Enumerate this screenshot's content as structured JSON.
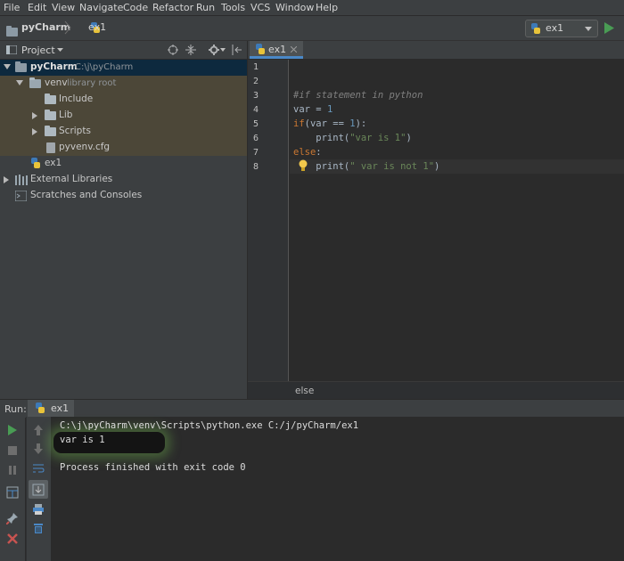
{
  "menu": [
    "File",
    "Edit",
    "View",
    "Navigate",
    "Code",
    "Refactor",
    "Run",
    "Tools",
    "VCS",
    "Window",
    "Help"
  ],
  "navbar": {
    "project": "pyCharm",
    "file": "ex1",
    "run_config": "ex1"
  },
  "project_panel": {
    "title": "Project",
    "tree": [
      {
        "label": "pyCharm",
        "hint": "C:\\j\\pyCharm"
      },
      {
        "label": "venv",
        "hint": "library root"
      },
      {
        "label": "Include"
      },
      {
        "label": "Lib"
      },
      {
        "label": "Scripts"
      },
      {
        "label": "pyvenv.cfg"
      },
      {
        "label": "ex1"
      },
      {
        "label": "External Libraries"
      },
      {
        "label": "Scratches and Consoles"
      }
    ]
  },
  "editor": {
    "tab": "ex1",
    "line_numbers": [
      "1",
      "2",
      "3",
      "4",
      "5",
      "6",
      "7",
      "8"
    ],
    "code": {
      "l3_comment": "#if statement in python",
      "l4_var": "var",
      "l4_eq": " = ",
      "l4_num": "1",
      "l5_if": "if",
      "l5_open": "(var == ",
      "l5_num": "1",
      "l5_close": "):",
      "l6_print": "    print(",
      "l6_str": "\"var is 1\"",
      "l6_close": ")",
      "l7_else": "else",
      "l7_colon": ":",
      "l8_print": "    print(",
      "l8_str": "\" var is not 1\"",
      "l8_close": ")"
    },
    "breadcrumb": "else"
  },
  "run_panel": {
    "label": "Run:",
    "tab": "ex1",
    "output": [
      "C:\\j\\pyCharm\\venv\\Scripts\\python.exe C:/j/pyCharm/ex1",
      "var is 1",
      "",
      "Process finished with exit code 0"
    ]
  },
  "colors": {
    "run_green": "#499c54",
    "stop_red": "#c75450",
    "keyword": "#cc7832",
    "number": "#6897bb",
    "string": "#6a8759"
  }
}
